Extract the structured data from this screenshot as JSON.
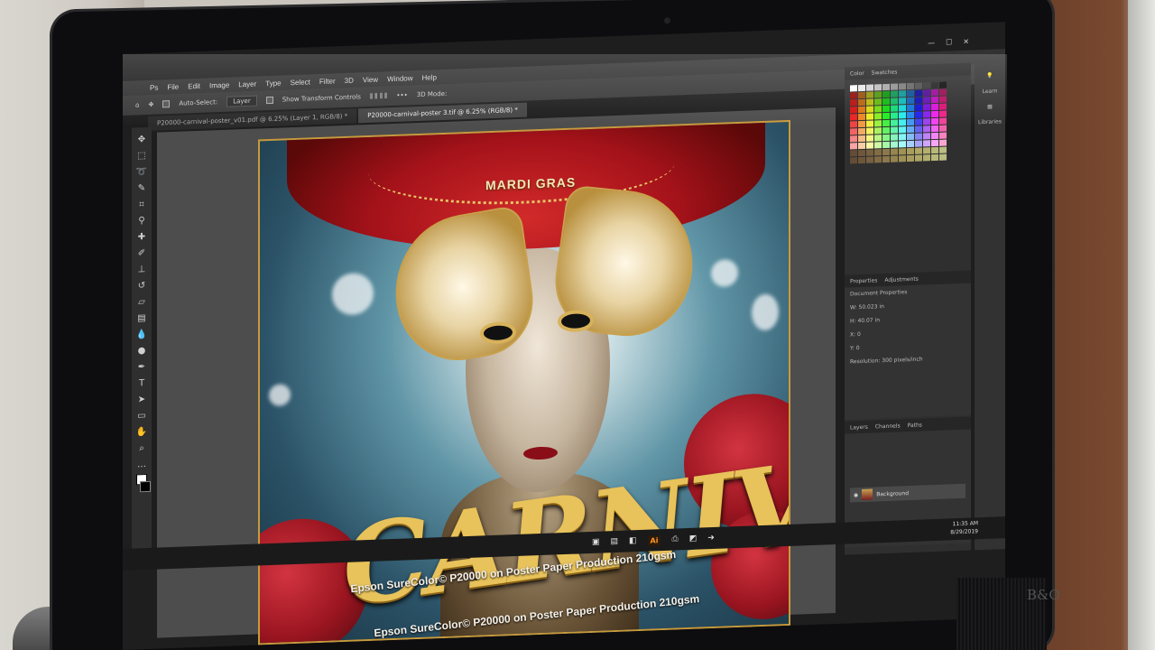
{
  "app": {
    "menu": [
      "Ps",
      "File",
      "Edit",
      "Image",
      "Layer",
      "Type",
      "Select",
      "Filter",
      "3D",
      "View",
      "Window",
      "Help"
    ],
    "options": {
      "auto_select": "Auto-Select:",
      "layer_mode": "Layer",
      "transform": "Show Transform Controls",
      "mode_3d": "3D Mode:"
    },
    "tabs": [
      {
        "label": "P20000-carnival-poster_v01.pdf @ 6.25% (Layer 1, RGB/8) *",
        "active": false
      },
      {
        "label": "P20000-carnival-poster 3.tif @ 6.25% (RGB/8) *",
        "active": true
      }
    ],
    "tool_icons": [
      "move-icon",
      "marquee-icon",
      "lasso-icon",
      "quick-select-icon",
      "crop-icon",
      "eyedropper-icon",
      "healing-icon",
      "brush-icon",
      "stamp-icon",
      "history-brush-icon",
      "eraser-icon",
      "gradient-icon",
      "blur-icon",
      "dodge-icon",
      "pen-icon",
      "type-icon",
      "path-select-icon",
      "shape-icon",
      "hand-icon",
      "zoom-icon"
    ],
    "panels": {
      "color_tabs": [
        "Color",
        "Swatches"
      ],
      "props_tabs": [
        "Properties",
        "Adjustments"
      ],
      "doc_props": "Document Properties",
      "w": "W: 50.023 in",
      "h": "H: 40.07 in",
      "x": "X: 0",
      "y": "Y: 0",
      "resolution": "Resolution: 300 pixels/inch",
      "layer_tabs": [
        "Layers",
        "Channels",
        "Paths"
      ],
      "layer_name": "Background",
      "side": [
        "Learn",
        "Libraries"
      ]
    },
    "taskbar": {
      "time": "11:35 AM",
      "date": "8/29/2019",
      "ai_label": "Ai"
    }
  },
  "poster": {
    "header": "MARDI GRAS",
    "title": "CARNIVAL",
    "caption": "Epson SureColor© P20000 on Poster Paper Production 210gsm",
    "caption2": "Epson SureColor© P20000 on Poster Paper Production 210gsm"
  },
  "monitor": {
    "brand": "B&O"
  },
  "colors": {
    "ps_dark": "#323232",
    "gold": "#e8c25a",
    "mask_red": "#a5121a",
    "sky": "#5f95a6"
  }
}
